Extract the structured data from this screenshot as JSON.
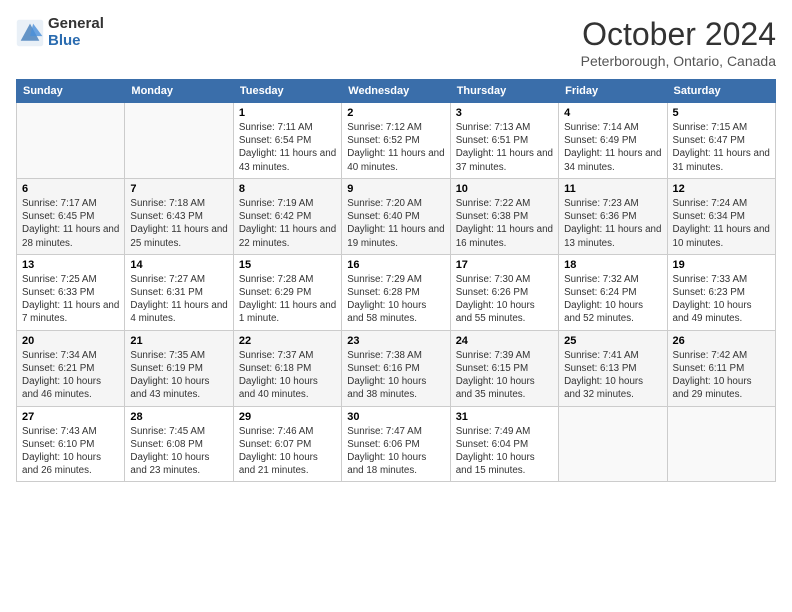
{
  "logo": {
    "general": "General",
    "blue": "Blue"
  },
  "header": {
    "month": "October 2024",
    "location": "Peterborough, Ontario, Canada"
  },
  "weekdays": [
    "Sunday",
    "Monday",
    "Tuesday",
    "Wednesday",
    "Thursday",
    "Friday",
    "Saturday"
  ],
  "weeks": [
    [
      {
        "day": "",
        "info": ""
      },
      {
        "day": "",
        "info": ""
      },
      {
        "day": "1",
        "info": "Sunrise: 7:11 AM\nSunset: 6:54 PM\nDaylight: 11 hours and 43 minutes."
      },
      {
        "day": "2",
        "info": "Sunrise: 7:12 AM\nSunset: 6:52 PM\nDaylight: 11 hours and 40 minutes."
      },
      {
        "day": "3",
        "info": "Sunrise: 7:13 AM\nSunset: 6:51 PM\nDaylight: 11 hours and 37 minutes."
      },
      {
        "day": "4",
        "info": "Sunrise: 7:14 AM\nSunset: 6:49 PM\nDaylight: 11 hours and 34 minutes."
      },
      {
        "day": "5",
        "info": "Sunrise: 7:15 AM\nSunset: 6:47 PM\nDaylight: 11 hours and 31 minutes."
      }
    ],
    [
      {
        "day": "6",
        "info": "Sunrise: 7:17 AM\nSunset: 6:45 PM\nDaylight: 11 hours and 28 minutes."
      },
      {
        "day": "7",
        "info": "Sunrise: 7:18 AM\nSunset: 6:43 PM\nDaylight: 11 hours and 25 minutes."
      },
      {
        "day": "8",
        "info": "Sunrise: 7:19 AM\nSunset: 6:42 PM\nDaylight: 11 hours and 22 minutes."
      },
      {
        "day": "9",
        "info": "Sunrise: 7:20 AM\nSunset: 6:40 PM\nDaylight: 11 hours and 19 minutes."
      },
      {
        "day": "10",
        "info": "Sunrise: 7:22 AM\nSunset: 6:38 PM\nDaylight: 11 hours and 16 minutes."
      },
      {
        "day": "11",
        "info": "Sunrise: 7:23 AM\nSunset: 6:36 PM\nDaylight: 11 hours and 13 minutes."
      },
      {
        "day": "12",
        "info": "Sunrise: 7:24 AM\nSunset: 6:34 PM\nDaylight: 11 hours and 10 minutes."
      }
    ],
    [
      {
        "day": "13",
        "info": "Sunrise: 7:25 AM\nSunset: 6:33 PM\nDaylight: 11 hours and 7 minutes."
      },
      {
        "day": "14",
        "info": "Sunrise: 7:27 AM\nSunset: 6:31 PM\nDaylight: 11 hours and 4 minutes."
      },
      {
        "day": "15",
        "info": "Sunrise: 7:28 AM\nSunset: 6:29 PM\nDaylight: 11 hours and 1 minute."
      },
      {
        "day": "16",
        "info": "Sunrise: 7:29 AM\nSunset: 6:28 PM\nDaylight: 10 hours and 58 minutes."
      },
      {
        "day": "17",
        "info": "Sunrise: 7:30 AM\nSunset: 6:26 PM\nDaylight: 10 hours and 55 minutes."
      },
      {
        "day": "18",
        "info": "Sunrise: 7:32 AM\nSunset: 6:24 PM\nDaylight: 10 hours and 52 minutes."
      },
      {
        "day": "19",
        "info": "Sunrise: 7:33 AM\nSunset: 6:23 PM\nDaylight: 10 hours and 49 minutes."
      }
    ],
    [
      {
        "day": "20",
        "info": "Sunrise: 7:34 AM\nSunset: 6:21 PM\nDaylight: 10 hours and 46 minutes."
      },
      {
        "day": "21",
        "info": "Sunrise: 7:35 AM\nSunset: 6:19 PM\nDaylight: 10 hours and 43 minutes."
      },
      {
        "day": "22",
        "info": "Sunrise: 7:37 AM\nSunset: 6:18 PM\nDaylight: 10 hours and 40 minutes."
      },
      {
        "day": "23",
        "info": "Sunrise: 7:38 AM\nSunset: 6:16 PM\nDaylight: 10 hours and 38 minutes."
      },
      {
        "day": "24",
        "info": "Sunrise: 7:39 AM\nSunset: 6:15 PM\nDaylight: 10 hours and 35 minutes."
      },
      {
        "day": "25",
        "info": "Sunrise: 7:41 AM\nSunset: 6:13 PM\nDaylight: 10 hours and 32 minutes."
      },
      {
        "day": "26",
        "info": "Sunrise: 7:42 AM\nSunset: 6:11 PM\nDaylight: 10 hours and 29 minutes."
      }
    ],
    [
      {
        "day": "27",
        "info": "Sunrise: 7:43 AM\nSunset: 6:10 PM\nDaylight: 10 hours and 26 minutes."
      },
      {
        "day": "28",
        "info": "Sunrise: 7:45 AM\nSunset: 6:08 PM\nDaylight: 10 hours and 23 minutes."
      },
      {
        "day": "29",
        "info": "Sunrise: 7:46 AM\nSunset: 6:07 PM\nDaylight: 10 hours and 21 minutes."
      },
      {
        "day": "30",
        "info": "Sunrise: 7:47 AM\nSunset: 6:06 PM\nDaylight: 10 hours and 18 minutes."
      },
      {
        "day": "31",
        "info": "Sunrise: 7:49 AM\nSunset: 6:04 PM\nDaylight: 10 hours and 15 minutes."
      },
      {
        "day": "",
        "info": ""
      },
      {
        "day": "",
        "info": ""
      }
    ]
  ]
}
